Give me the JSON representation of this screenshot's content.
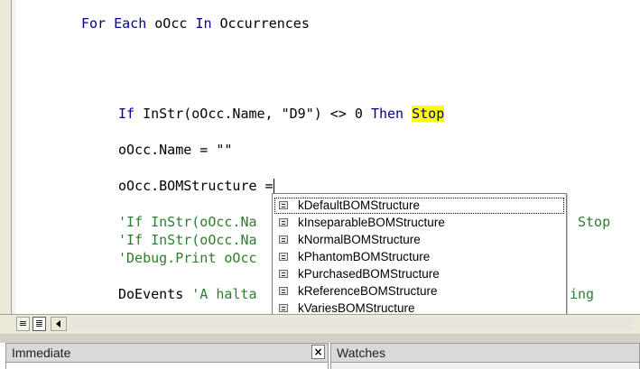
{
  "code": {
    "line_for_each": {
      "kw_for": "For",
      "kw_each": "Each",
      "var": " oOcc ",
      "kw_in": "In",
      "rest": " Occurrences"
    },
    "line_if": {
      "kw_if": "If",
      "expr": " InStr(oOcc.Name, \"D9\") <> 0 ",
      "kw_then": "Then",
      "space": " ",
      "kw_stop": "Stop"
    },
    "line_name": "oOcc.Name = \"\"",
    "line_bom": "oOcc.BOMStructure =",
    "comment_1": "'If InStr(oOcc.Na",
    "comment_1_tail": "Stop",
    "comment_2": "'If InStr(oOcc.Na",
    "comment_3": "'Debug.Print oOcc",
    "line_doevents": "DoEvents",
    "comment_halta": " 'A halta",
    "comment_halta_tail": "ing"
  },
  "autocomplete": {
    "items": [
      "kDefaultBOMStructure",
      "kInseparableBOMStructure",
      "kNormalBOMStructure",
      "kPhantomBOMStructure",
      "kPurchasedBOMStructure",
      "kReferenceBOMStructure",
      "kVariesBOMStructure"
    ],
    "selected_index": 0
  },
  "panes": {
    "immediate_title": "Immediate",
    "close_glyph": "×",
    "watches_title": "Watches"
  },
  "view_buttons": {
    "procedure_glyph": "≡",
    "full_module_glyph": "≣"
  },
  "colors": {
    "keyword": "#00008b",
    "comment": "#2e7d2e",
    "highlight": "#ffff00",
    "exec_arrow": "#ffee00"
  }
}
